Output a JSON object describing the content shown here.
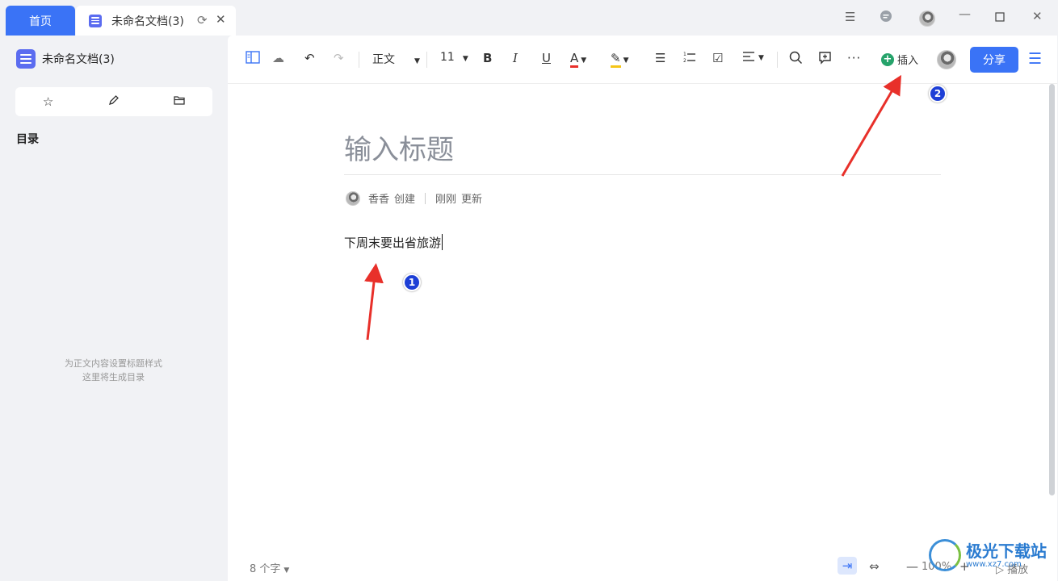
{
  "tabs": {
    "home_label": "首页",
    "doc_label": "未命名文档(3)"
  },
  "sidebar": {
    "doc_title": "未命名文档(3)",
    "toc_heading": "目录",
    "empty_line1": "为正文内容设置标题样式",
    "empty_line2": "这里将生成目录"
  },
  "toolbar": {
    "paragraph_style": "正文",
    "font_size": "11",
    "insert_label": "插入",
    "share_label": "分享"
  },
  "document": {
    "title_placeholder": "输入标题",
    "author": "香香",
    "created_label": "创建",
    "updated_time": "刚刚",
    "updated_label": "更新",
    "body_text": "下周末要出省旅游"
  },
  "footer": {
    "word_count": "8 个字",
    "zoom": "100%",
    "play_label": "播放"
  },
  "annotations": {
    "badge1": "1",
    "badge2": "2"
  },
  "watermark": {
    "name": "极光下载站",
    "url": "www.xz7.com"
  },
  "colors": {
    "accent": "#3a73f6",
    "annotation_arrow": "#e8302a",
    "insert_icon": "#26a36b"
  },
  "icons": [
    "doc-icon",
    "reload-icon",
    "close-icon",
    "list-icon",
    "chat-icon",
    "minimize-icon",
    "maximize-icon",
    "star-icon",
    "edit-icon",
    "folder-icon",
    "sidebar-toggle-icon",
    "cloud-icon",
    "undo-icon",
    "redo-icon",
    "bold-icon",
    "italic-icon",
    "underline-icon",
    "font-color-icon",
    "highlight-icon",
    "bullet-list-icon",
    "numbered-list-icon",
    "checkbox-icon",
    "align-icon",
    "search-icon",
    "comment-icon",
    "more-icon",
    "menu-icon"
  ]
}
